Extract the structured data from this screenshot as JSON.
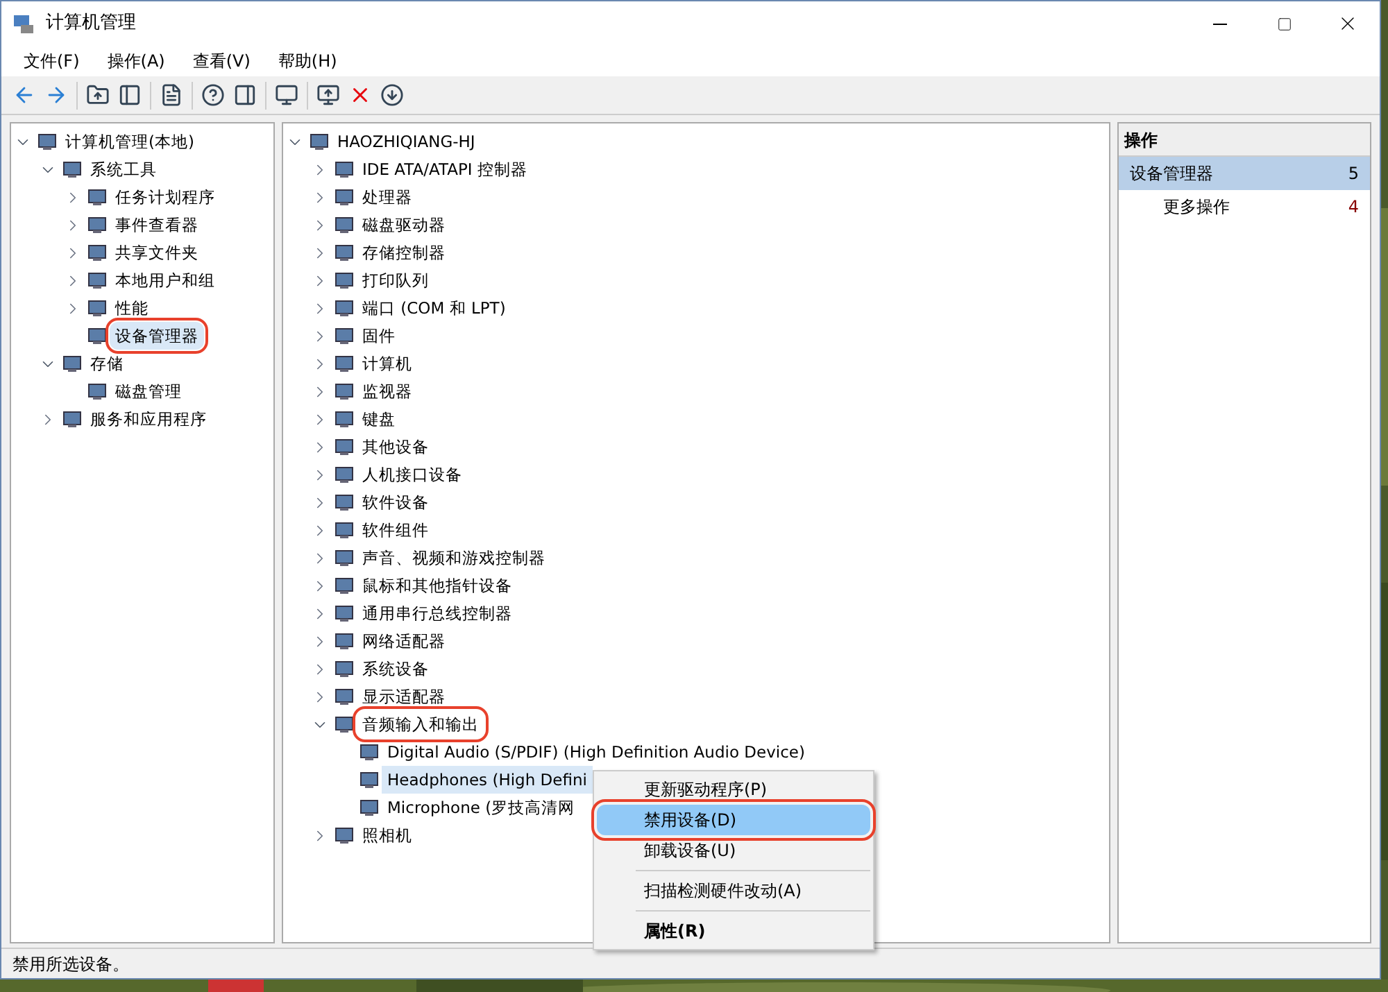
{
  "window": {
    "title": "计算机管理"
  },
  "menu": [
    "文件(F)",
    "操作(A)",
    "查看(V)",
    "帮助(H)"
  ],
  "left_tree": [
    {
      "label": "计算机管理(本地)",
      "expanded": true,
      "selected": false,
      "annotated": false,
      "children": [
        {
          "label": "系统工具",
          "expanded": true,
          "selected": false,
          "annotated": false,
          "children": [
            {
              "label": "任务计划程序",
              "expanded": false,
              "selected": false,
              "annotated": false
            },
            {
              "label": "事件查看器",
              "expanded": false,
              "selected": false,
              "annotated": false
            },
            {
              "label": "共享文件夹",
              "expanded": false,
              "selected": false,
              "annotated": false
            },
            {
              "label": "本地用户和组",
              "expanded": false,
              "selected": false,
              "annotated": false
            },
            {
              "label": "性能",
              "expanded": false,
              "selected": false,
              "annotated": false
            },
            {
              "label": "设备管理器",
              "selected": true,
              "annotated": true
            }
          ]
        },
        {
          "label": "存储",
          "expanded": true,
          "selected": false,
          "annotated": false,
          "children": [
            {
              "label": "磁盘管理",
              "selected": false,
              "annotated": false
            }
          ]
        },
        {
          "label": "服务和应用程序",
          "expanded": false,
          "selected": false,
          "annotated": false
        }
      ]
    }
  ],
  "device_tree": [
    {
      "label": "HAOZHIQIANG-HJ",
      "expanded": true,
      "selected": false,
      "annotated": false,
      "children": [
        {
          "label": "IDE ATA/ATAPI 控制器",
          "expanded": false,
          "selected": false,
          "annotated": false
        },
        {
          "label": "处理器",
          "expanded": false,
          "selected": false,
          "annotated": false
        },
        {
          "label": "磁盘驱动器",
          "expanded": false,
          "selected": false,
          "annotated": false
        },
        {
          "label": "存储控制器",
          "expanded": false,
          "selected": false,
          "annotated": false
        },
        {
          "label": "打印队列",
          "expanded": false,
          "selected": false,
          "annotated": false
        },
        {
          "label": "端口 (COM 和 LPT)",
          "expanded": false,
          "selected": false,
          "annotated": false
        },
        {
          "label": "固件",
          "expanded": false,
          "selected": false,
          "annotated": false
        },
        {
          "label": "计算机",
          "expanded": false,
          "selected": false,
          "annotated": false
        },
        {
          "label": "监视器",
          "expanded": false,
          "selected": false,
          "annotated": false
        },
        {
          "label": "键盘",
          "expanded": false,
          "selected": false,
          "annotated": false
        },
        {
          "label": "其他设备",
          "expanded": false,
          "selected": false,
          "annotated": false
        },
        {
          "label": "人机接口设备",
          "expanded": false,
          "selected": false,
          "annotated": false
        },
        {
          "label": "软件设备",
          "expanded": false,
          "selected": false,
          "annotated": false
        },
        {
          "label": "软件组件",
          "expanded": false,
          "selected": false,
          "annotated": false
        },
        {
          "label": "声音、视频和游戏控制器",
          "expanded": false,
          "selected": false,
          "annotated": false
        },
        {
          "label": "鼠标和其他指针设备",
          "expanded": false,
          "selected": false,
          "annotated": false
        },
        {
          "label": "通用串行总线控制器",
          "expanded": false,
          "selected": false,
          "annotated": false
        },
        {
          "label": "网络适配器",
          "expanded": false,
          "selected": false,
          "annotated": false
        },
        {
          "label": "系统设备",
          "expanded": false,
          "selected": false,
          "annotated": false
        },
        {
          "label": "显示适配器",
          "expanded": false,
          "selected": false,
          "annotated": false
        },
        {
          "label": "音频输入和输出",
          "expanded": true,
          "selected": false,
          "annotated": true,
          "children": [
            {
              "label": "Digital Audio (S/PDIF) (High Definition Audio Device)",
              "selected": false,
              "annotated": false
            },
            {
              "label": "Headphones (High Defini",
              "selected": true,
              "annotated": false
            },
            {
              "label": "Microphone (罗技高清网",
              "selected": false,
              "annotated": false
            }
          ]
        },
        {
          "label": "照相机",
          "expanded": false,
          "selected": false,
          "annotated": false
        }
      ]
    }
  ],
  "actions": {
    "header": "操作",
    "items": [
      {
        "label": "设备管理器",
        "count": "5",
        "selected": true
      },
      {
        "label": "更多操作",
        "count": "4",
        "selected": false
      }
    ]
  },
  "context_menu": [
    {
      "kind": "item",
      "label": "更新驱动程序(P)",
      "selected": false,
      "annotated": false,
      "bold": false
    },
    {
      "kind": "item",
      "label": "禁用设备(D)",
      "selected": true,
      "annotated": true,
      "bold": false
    },
    {
      "kind": "item",
      "label": "卸载设备(U)",
      "selected": false,
      "annotated": false,
      "bold": false
    },
    {
      "kind": "separator"
    },
    {
      "kind": "item",
      "label": "扫描检测硬件改动(A)",
      "selected": false,
      "annotated": false,
      "bold": false
    },
    {
      "kind": "separator"
    },
    {
      "kind": "item",
      "label": "属性(R)",
      "selected": false,
      "annotated": false,
      "bold": true
    }
  ],
  "status_bar": "禁用所选设备。"
}
